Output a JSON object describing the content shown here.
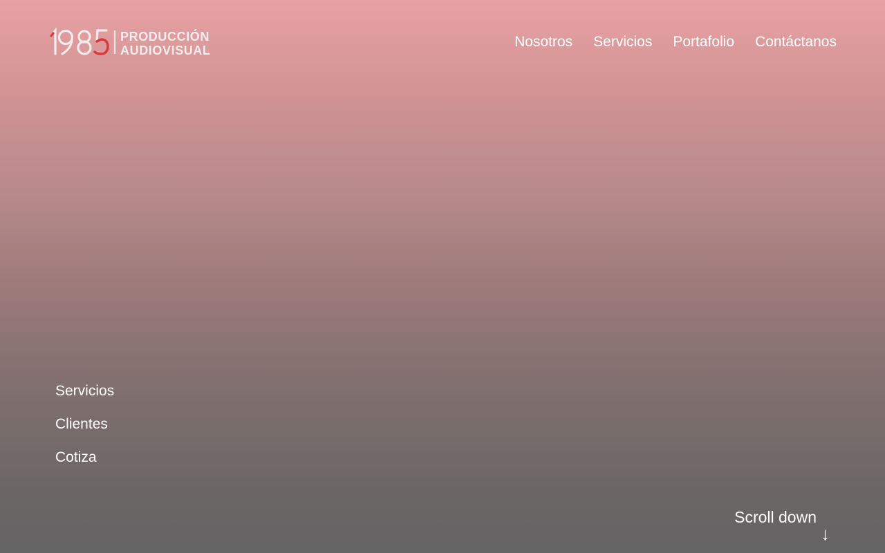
{
  "brand": {
    "logo_year": "1985",
    "logo_line1": "PRODUCCIÓN",
    "logo_line2": "AUDIOVISUAL",
    "logo_color": "#f2ecec",
    "accent_color": "#d6383e"
  },
  "nav": {
    "items": [
      {
        "label": "Nosotros"
      },
      {
        "label": "Servicios"
      },
      {
        "label": "Portafolio"
      },
      {
        "label": "Contáctanos"
      }
    ]
  },
  "side_links": [
    {
      "label": "Servicios"
    },
    {
      "label": "Clientes"
    },
    {
      "label": "Cotiza"
    }
  ],
  "scroll": {
    "label": "Scroll down",
    "icon": "arrow-down-icon",
    "glyph": "↓"
  },
  "colors": {
    "gradient_top": "#e8a2a3",
    "gradient_bottom": "#646464",
    "text": "#ffffff"
  }
}
